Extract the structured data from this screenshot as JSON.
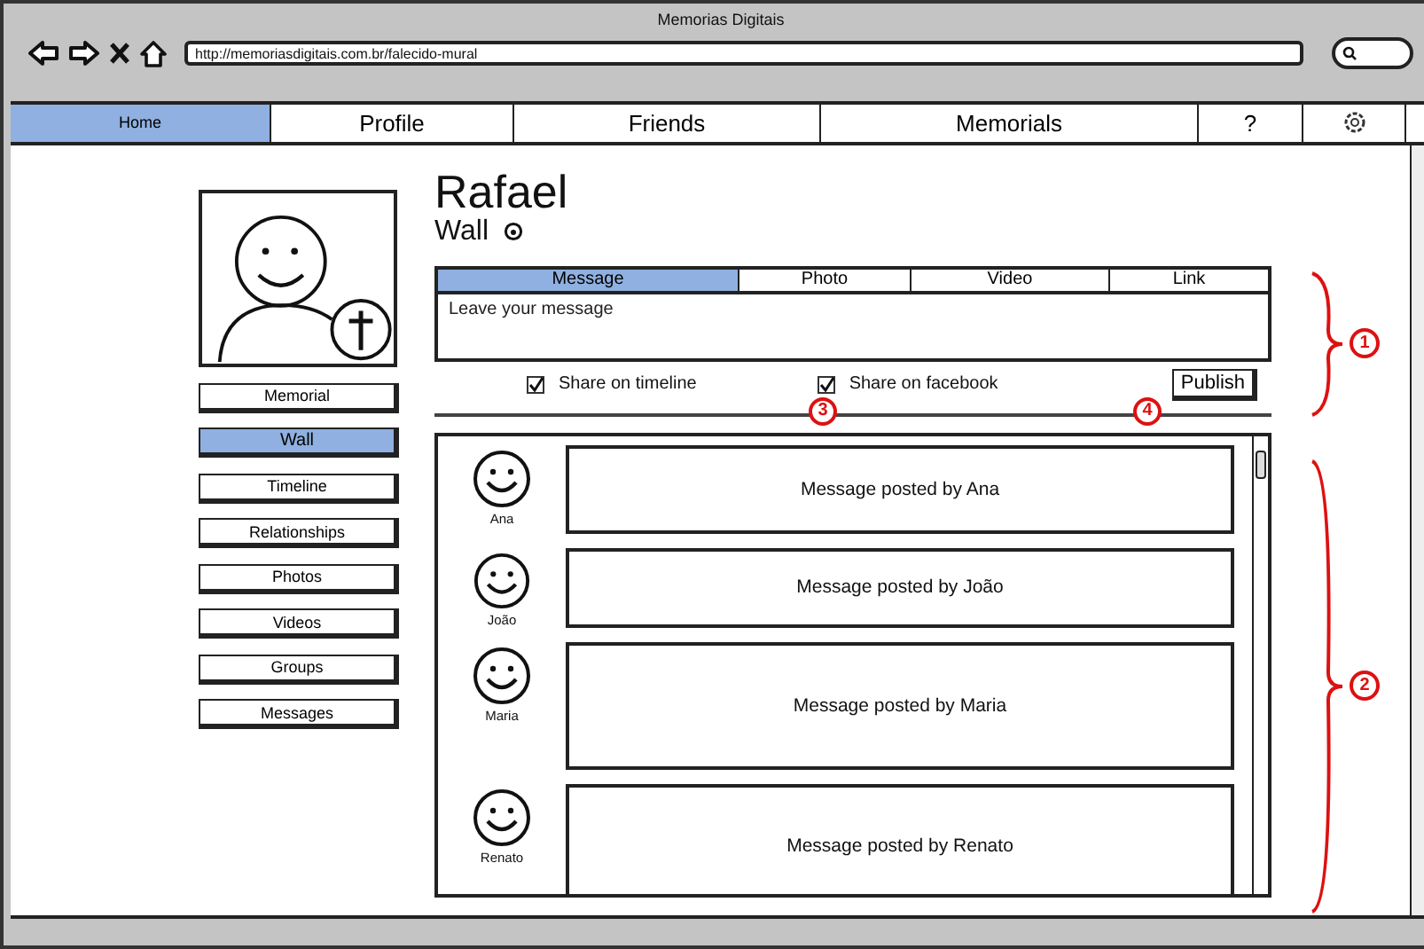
{
  "window": {
    "title": "Memorias Digitais"
  },
  "address_bar": {
    "value": "http://memoriasdigitais.com.br/falecido-mural"
  },
  "nav": [
    {
      "label": "Home",
      "kind": "text",
      "selected": true
    },
    {
      "label": "Profile",
      "kind": "text",
      "selected": false
    },
    {
      "label": "Friends",
      "kind": "text",
      "selected": false
    },
    {
      "label": "Memorials",
      "kind": "text",
      "selected": false
    },
    {
      "label": "?",
      "kind": "text",
      "selected": false
    },
    {
      "kind": "gear",
      "selected": false
    }
  ],
  "sidebar": {
    "items": [
      {
        "label": "Memorial",
        "selected": false
      },
      {
        "label": "Wall",
        "selected": true
      },
      {
        "label": "Timeline",
        "selected": false
      },
      {
        "label": "Relationships",
        "selected": false
      },
      {
        "label": "Photos",
        "selected": false
      },
      {
        "label": "Videos",
        "selected": false
      },
      {
        "label": "Groups",
        "selected": false
      },
      {
        "label": "Messages",
        "selected": false
      }
    ]
  },
  "profile": {
    "name": "Rafael",
    "section": "Wall"
  },
  "composer": {
    "tabs": [
      {
        "label": "Message",
        "selected": true
      },
      {
        "label": "Photo",
        "selected": false
      },
      {
        "label": "Video",
        "selected": false
      },
      {
        "label": "Link",
        "selected": false
      }
    ],
    "placeholder": "Leave your message",
    "options": [
      {
        "label": "Share on timeline",
        "checked": true
      },
      {
        "label": "Share on facebook",
        "checked": true
      }
    ],
    "publish": "Publish"
  },
  "feed": [
    {
      "author": "Ana",
      "message": "Message posted by Ana"
    },
    {
      "author": "João",
      "message": "Message posted by João"
    },
    {
      "author": "Maria",
      "message": "Message posted by Maria"
    },
    {
      "author": "Renato",
      "message": "Message posted by Renato"
    }
  ],
  "annotations": [
    "1",
    "2",
    "3",
    "4"
  ]
}
